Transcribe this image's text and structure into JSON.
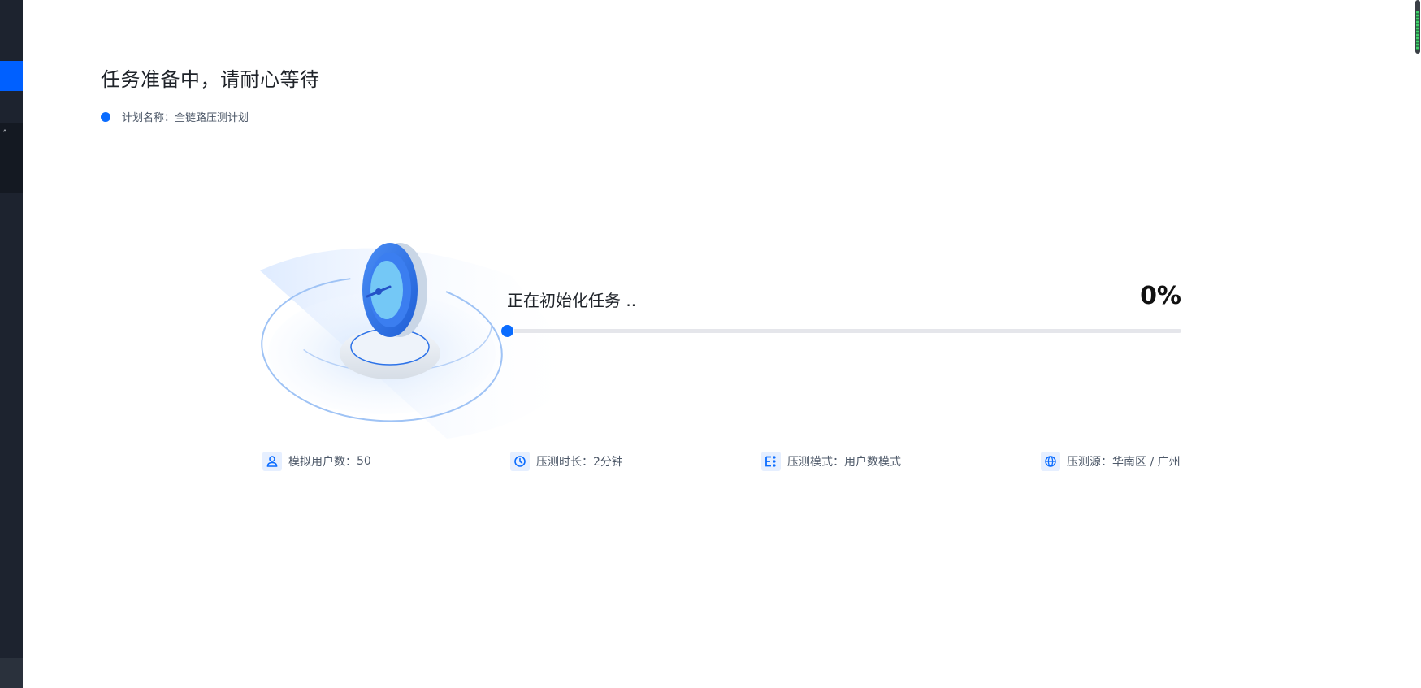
{
  "header": {
    "title": "任务准备中，请耐心等待",
    "plan_label": "计划名称：",
    "plan_name": "全链路压测计划"
  },
  "progress": {
    "status_text": "正在初始化任务 ..",
    "percent_text": "0%",
    "value": 0
  },
  "info": {
    "users_label": "模拟用户数：",
    "users_value": "50",
    "duration_label": "压测时长：",
    "duration_value": "2分钟",
    "mode_label": "压测模式：",
    "mode_value": "用户数模式",
    "source_label": "压测源：",
    "source_value": "华南区 / 广州"
  },
  "colors": {
    "accent": "#0a6cff",
    "sidebar": "#1d232f",
    "sidebar_active": "#0060ff",
    "track": "#e5e6eb",
    "icon_bg": "#e6efff"
  },
  "icons": {
    "users": "user-icon",
    "duration": "clock-icon",
    "mode": "mode-list-icon",
    "source": "globe-icon",
    "collapse": "chevron-up-icon"
  }
}
